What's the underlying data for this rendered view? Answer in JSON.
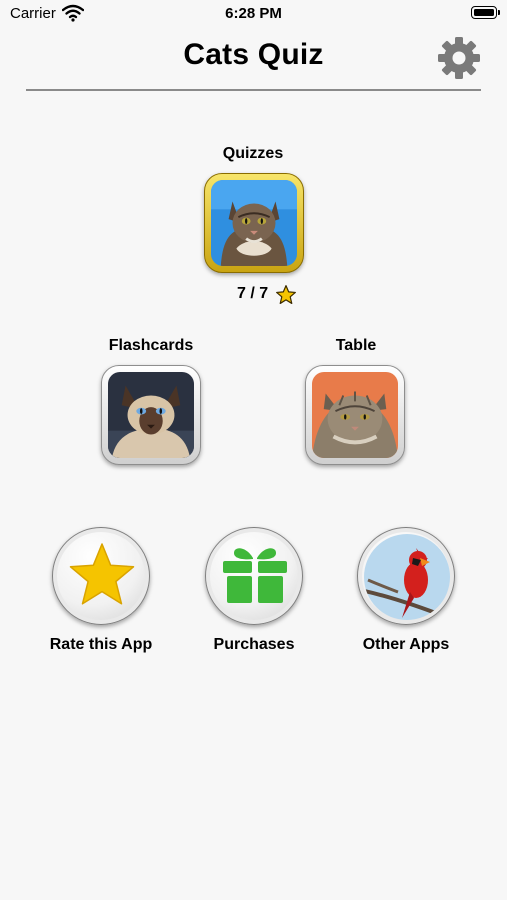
{
  "status_bar": {
    "carrier": "Carrier",
    "time": "6:28 PM"
  },
  "header": {
    "title": "Cats Quiz",
    "settings_icon": "gear-icon"
  },
  "quizzes": {
    "label": "Quizzes",
    "score": "7 / 7",
    "score_icon": "star-icon"
  },
  "flashcards": {
    "label": "Flashcards"
  },
  "table": {
    "label": "Table"
  },
  "actions": [
    {
      "label": "Rate this App",
      "icon": "star-icon"
    },
    {
      "label": "Purchases",
      "icon": "gift-icon"
    },
    {
      "label": "Other Apps",
      "icon": "cardinal-bird-icon"
    }
  ],
  "colors": {
    "accent_gold": "#e2c22a",
    "star_yellow": "#f5c400",
    "gift_green": "#3fb83a",
    "cardinal_red": "#d3201d"
  }
}
